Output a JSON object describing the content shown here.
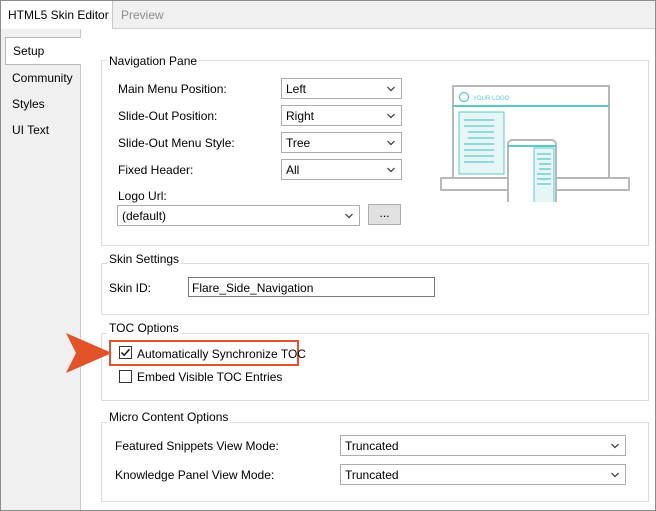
{
  "window": {
    "active_tab": "HTML5 Skin Editor",
    "inactive_tab": "Preview"
  },
  "sidebar": {
    "items": [
      {
        "label": "Setup",
        "active": true
      },
      {
        "label": "Community",
        "active": false
      },
      {
        "label": "Styles",
        "active": false
      },
      {
        "label": "UI Text",
        "active": false
      }
    ]
  },
  "navigation_pane": {
    "legend": "Navigation Pane",
    "main_menu_position": {
      "label": "Main Menu Position:",
      "value": "Left"
    },
    "slide_out_position": {
      "label": "Slide-Out Position:",
      "value": "Right"
    },
    "slide_out_menu_style": {
      "label": "Slide-Out Menu Style:",
      "value": "Tree"
    },
    "fixed_header": {
      "label": "Fixed Header:",
      "value": "All"
    },
    "logo_url": {
      "label": "Logo Url:",
      "value": "(default)",
      "browse_label": "..."
    },
    "preview_logo_text": "YOUR LOGO"
  },
  "skin_settings": {
    "legend": "Skin Settings",
    "skin_id": {
      "label": "Skin ID:",
      "value": "Flare_Side_Navigation"
    }
  },
  "toc_options": {
    "legend": "TOC Options",
    "auto_sync": {
      "label": "Automatically Synchronize TOC",
      "checked": true
    },
    "embed_visible": {
      "label": "Embed Visible TOC Entries",
      "checked": false
    }
  },
  "micro_content": {
    "legend": "Micro Content Options",
    "featured_snippets": {
      "label": "Featured Snippets View Mode:",
      "value": "Truncated"
    },
    "knowledge_panel": {
      "label": "Knowledge Panel View Mode:",
      "value": "Truncated"
    }
  },
  "colors": {
    "highlight": "#e2532a",
    "preview_accent": "#5bc8c8",
    "preview_frame": "#b8b8b8"
  }
}
